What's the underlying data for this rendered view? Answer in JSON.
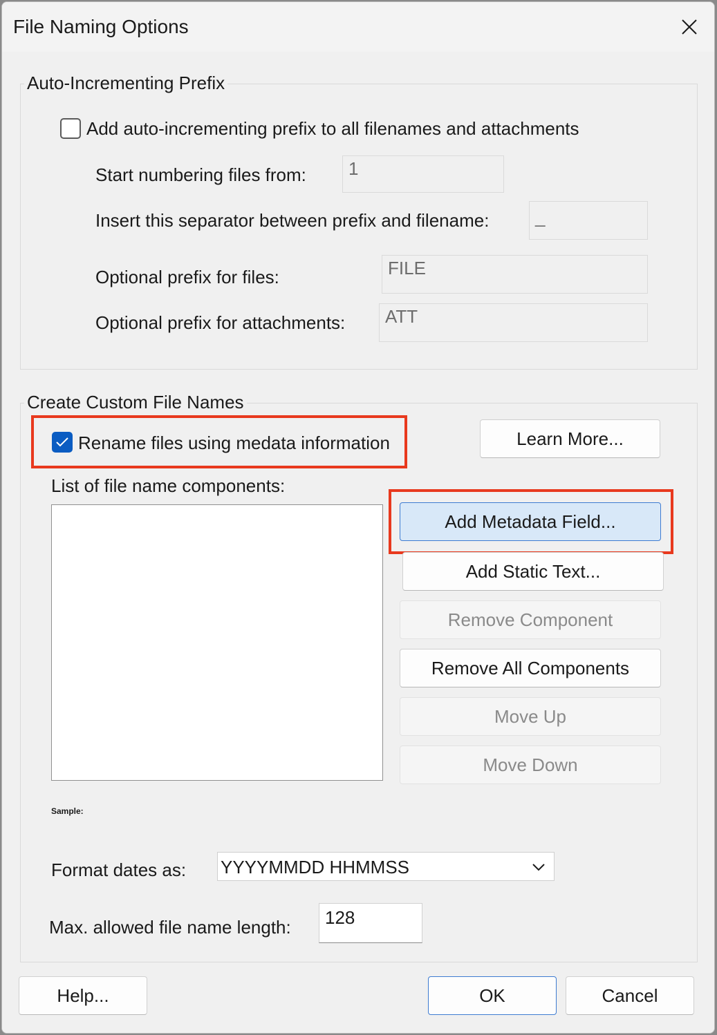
{
  "window": {
    "title": "File Naming Options",
    "close_icon": "close-icon"
  },
  "prefix_group": {
    "legend": "Auto-Incrementing Prefix",
    "add_prefix_label": "Add auto-incrementing prefix to all filenames and attachments",
    "add_prefix_checked": false,
    "start_label": "Start numbering files from:",
    "start_value": "1",
    "separator_label": "Insert this separator between prefix and filename:",
    "separator_value": "_",
    "file_prefix_label": "Optional prefix for files:",
    "file_prefix_value": "FILE",
    "attach_prefix_label": "Optional prefix for attachments:",
    "attach_prefix_value": "ATT"
  },
  "custom_group": {
    "legend": "Create Custom File Names",
    "rename_label": "Rename files using medata information",
    "rename_checked": true,
    "learn_more": "Learn More...",
    "list_label": "List of file name components:",
    "components": [],
    "buttons": {
      "add_metadata": "Add Metadata Field...",
      "add_static": "Add Static Text...",
      "remove_component": "Remove Component",
      "remove_all": "Remove All Components",
      "move_up": "Move Up",
      "move_down": "Move Down"
    },
    "sample_label": "Sample:",
    "date_format_label": "Format dates as:",
    "date_format_value": "YYYYMMDD HHMMSS",
    "max_length_label": "Max. allowed file name length:",
    "max_length_value": "128"
  },
  "footer": {
    "help": "Help...",
    "ok": "OK",
    "cancel": "Cancel"
  },
  "colors": {
    "highlight": "#e8391e",
    "accent": "#0a5cc2"
  }
}
